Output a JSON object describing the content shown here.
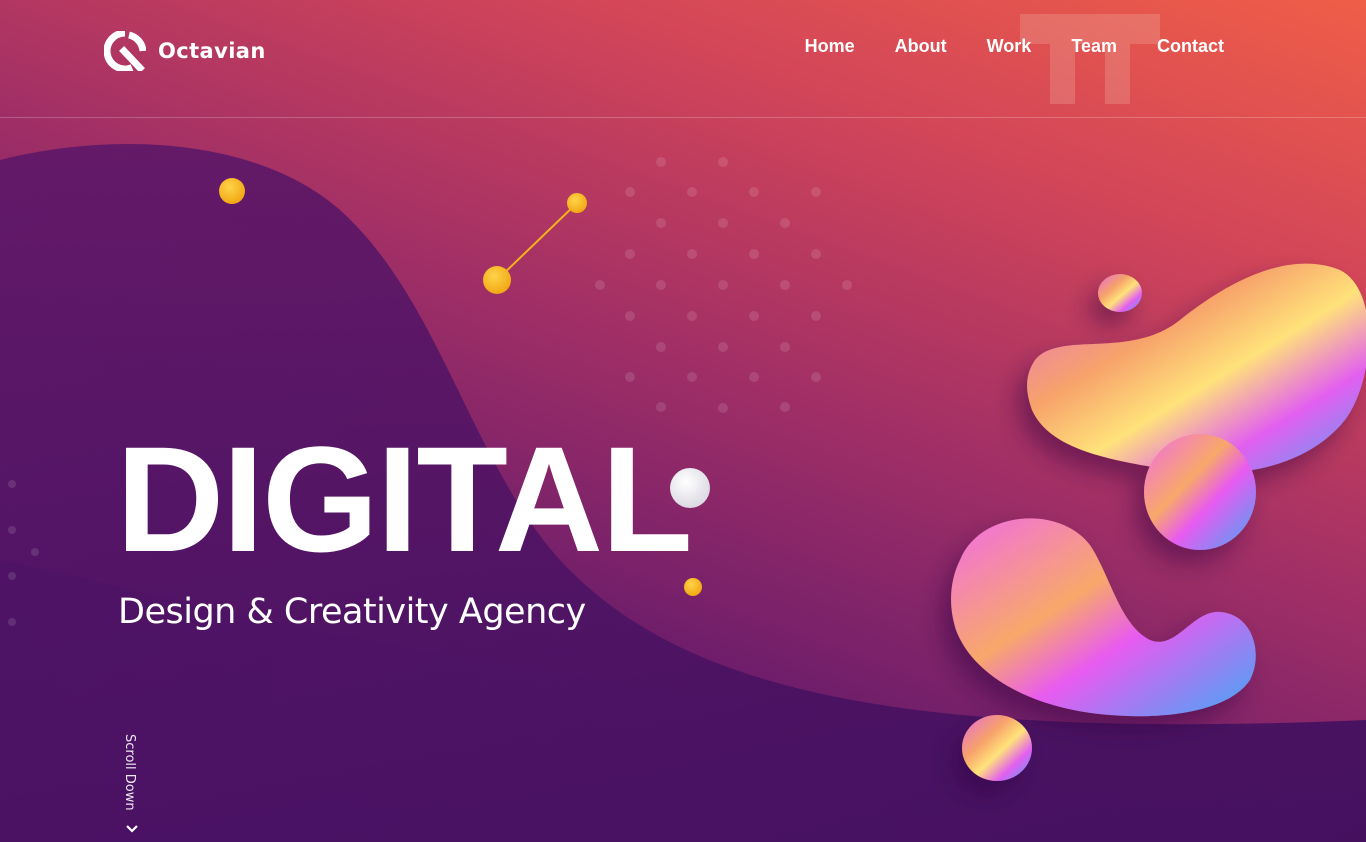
{
  "brand": {
    "name": "Octavian",
    "logo_icon": "q-logo-icon"
  },
  "nav": {
    "items": [
      {
        "label": "Home"
      },
      {
        "label": "About"
      },
      {
        "label": "Work"
      },
      {
        "label": "Team"
      },
      {
        "label": "Contact"
      }
    ]
  },
  "hero": {
    "title": "DIGITAL",
    "subtitle": "Design & Creativity Agency",
    "scroll_label": "Scroll Down",
    "scroll_icon": "chevron-down-icon"
  },
  "colors": {
    "gradient_top_right": "#ef5e47",
    "gradient_mid": "#a12f66",
    "gradient_bottom_left": "#4a1264",
    "accent_yellow": "#f5b21c",
    "text": "#ffffff"
  }
}
